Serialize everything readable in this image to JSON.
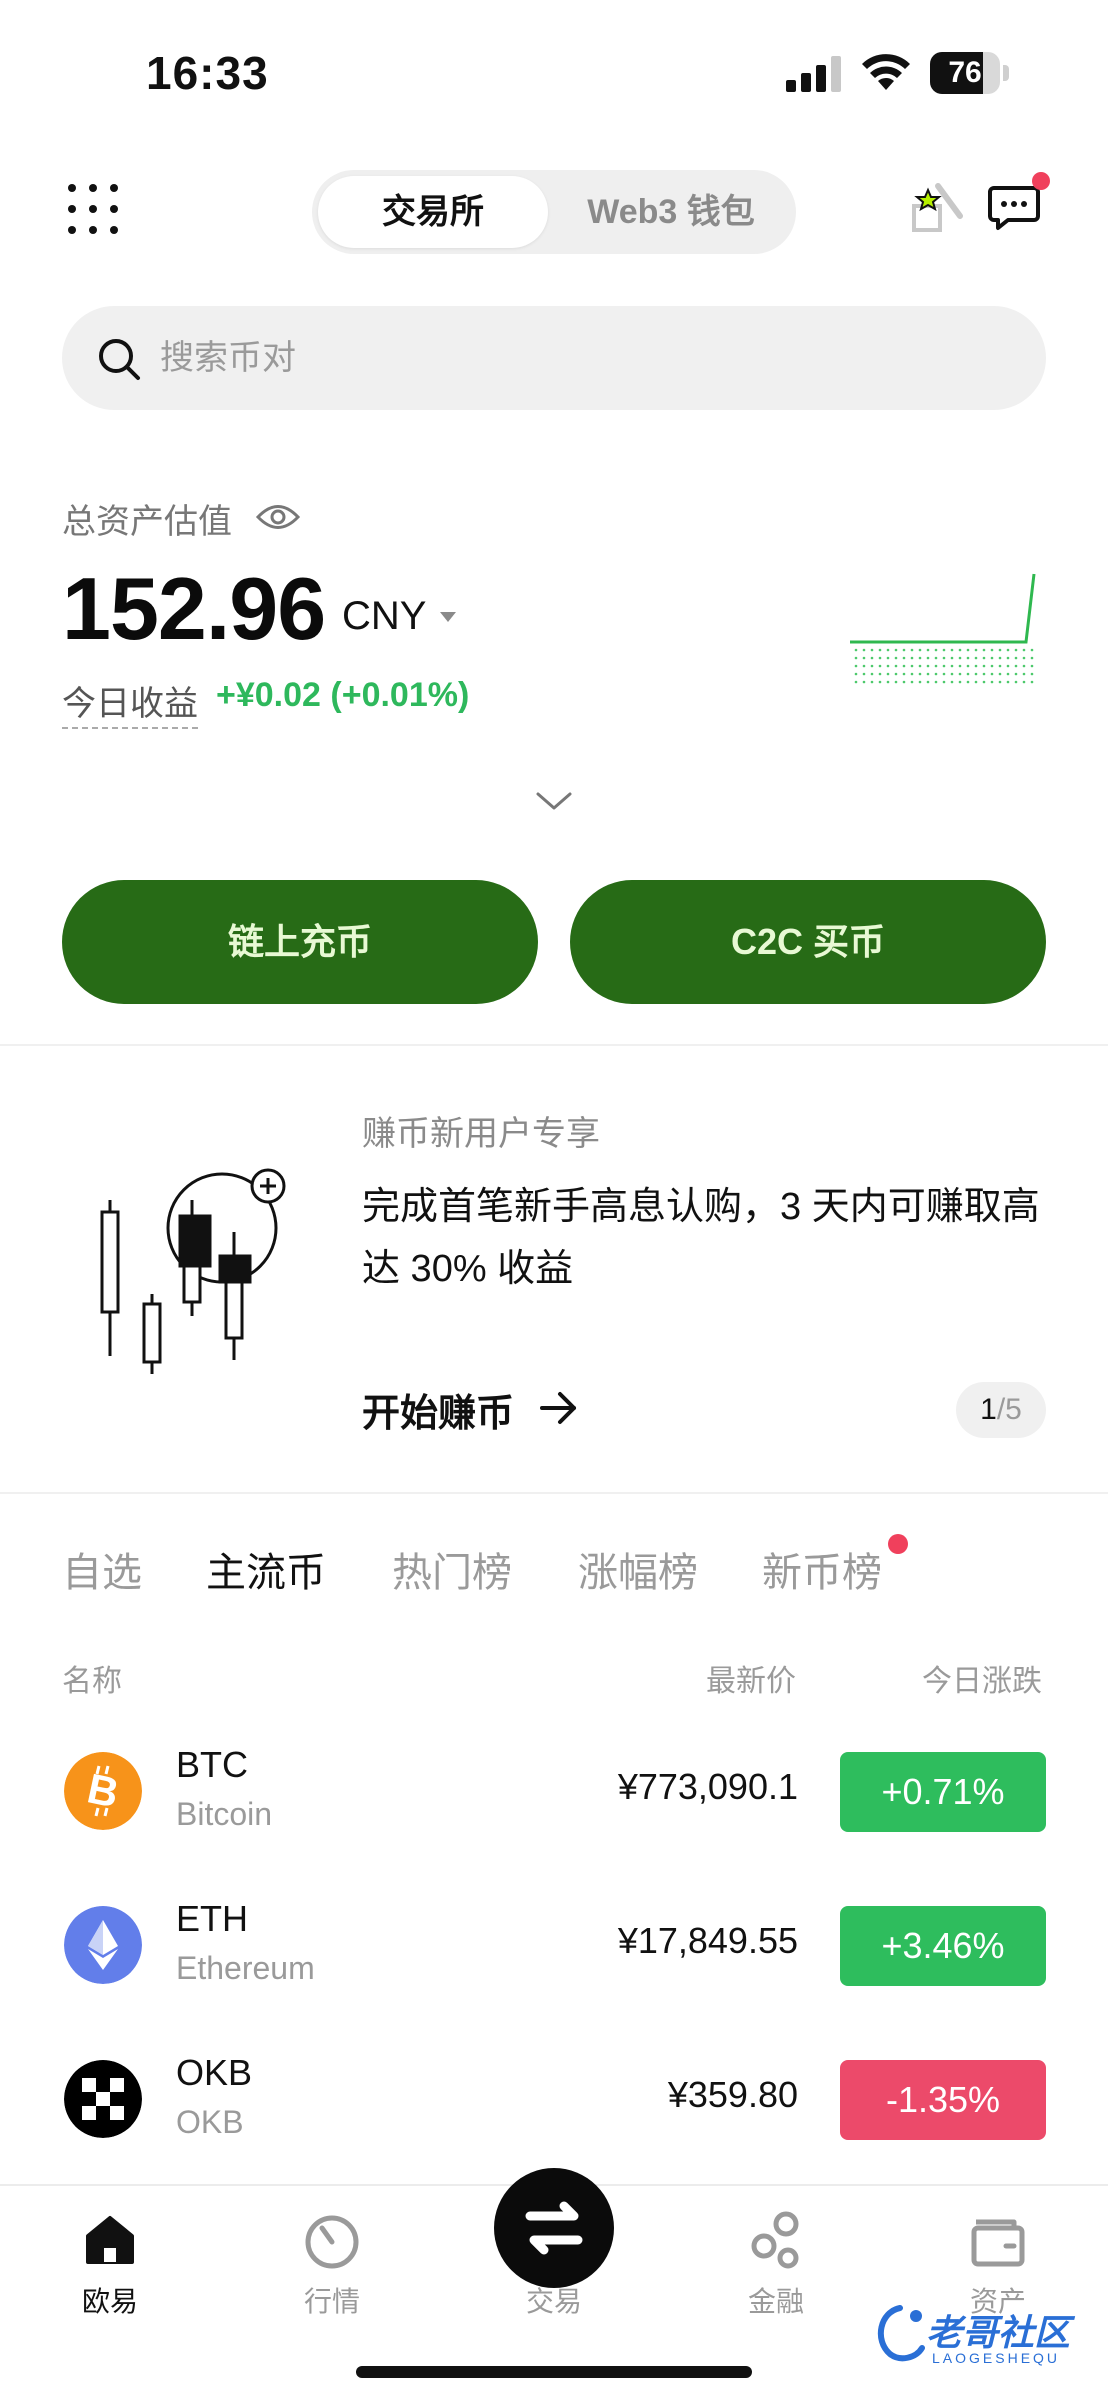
{
  "status_bar": {
    "time": "16:33",
    "battery": "76",
    "battery_level": 0.76
  },
  "header": {
    "tabs": [
      "交易所",
      "Web3 钱包"
    ],
    "active_tab": "交易所"
  },
  "search": {
    "placeholder": "搜索币对"
  },
  "assets": {
    "label": "总资产估值",
    "value": "152.96",
    "currency": "CNY",
    "today_label": "今日收益",
    "today_value": "+¥0.02 (+0.01%)"
  },
  "actions": {
    "deposit": "链上充币",
    "c2c": "C2C 买币"
  },
  "promo": {
    "subtitle": "赚币新用户专享",
    "title": "完成首笔新手高息认购，3 天内可赚取高达 30% 收益",
    "link": "开始赚币",
    "pager_current": "1",
    "pager_total": "/5"
  },
  "market_tabs": [
    {
      "label": "自选",
      "active": false
    },
    {
      "label": "主流币",
      "active": true
    },
    {
      "label": "热门榜",
      "active": false
    },
    {
      "label": "涨幅榜",
      "active": false
    },
    {
      "label": "新币榜",
      "active": false,
      "dot": true
    }
  ],
  "columns": {
    "name": "名称",
    "price": "最新价",
    "change": "今日涨跌"
  },
  "coins": [
    {
      "symbol": "BTC",
      "name": "Bitcoin",
      "price": "¥773,090.1",
      "change": "+0.71%",
      "direction": "up",
      "icon": "bitcoin-icon",
      "color": "#f7931a"
    },
    {
      "symbol": "ETH",
      "name": "Ethereum",
      "price": "¥17,849.55",
      "change": "+3.46%",
      "direction": "up",
      "icon": "ethereum-icon",
      "color": "#627eea"
    },
    {
      "symbol": "OKB",
      "name": "OKB",
      "price": "¥359.80",
      "change": "-1.35%",
      "direction": "down",
      "icon": "okb-icon",
      "color": "#000000"
    }
  ],
  "bottom_nav": [
    {
      "label": "欧易",
      "icon": "home-icon",
      "active": true
    },
    {
      "label": "行情",
      "icon": "market-icon",
      "active": false
    },
    {
      "label": "交易",
      "icon": "swap-icon",
      "active": false
    },
    {
      "label": "金融",
      "icon": "finance-icon",
      "active": false
    },
    {
      "label": "资产",
      "icon": "wallet-icon",
      "active": false
    }
  ],
  "watermark": {
    "text": "老哥社区",
    "sub": "LAOGESHEQU"
  },
  "colors": {
    "brand_green": "#276b16",
    "up": "#2ebd5d",
    "down": "#ec4a6a",
    "positive_text": "#2eb85c"
  }
}
